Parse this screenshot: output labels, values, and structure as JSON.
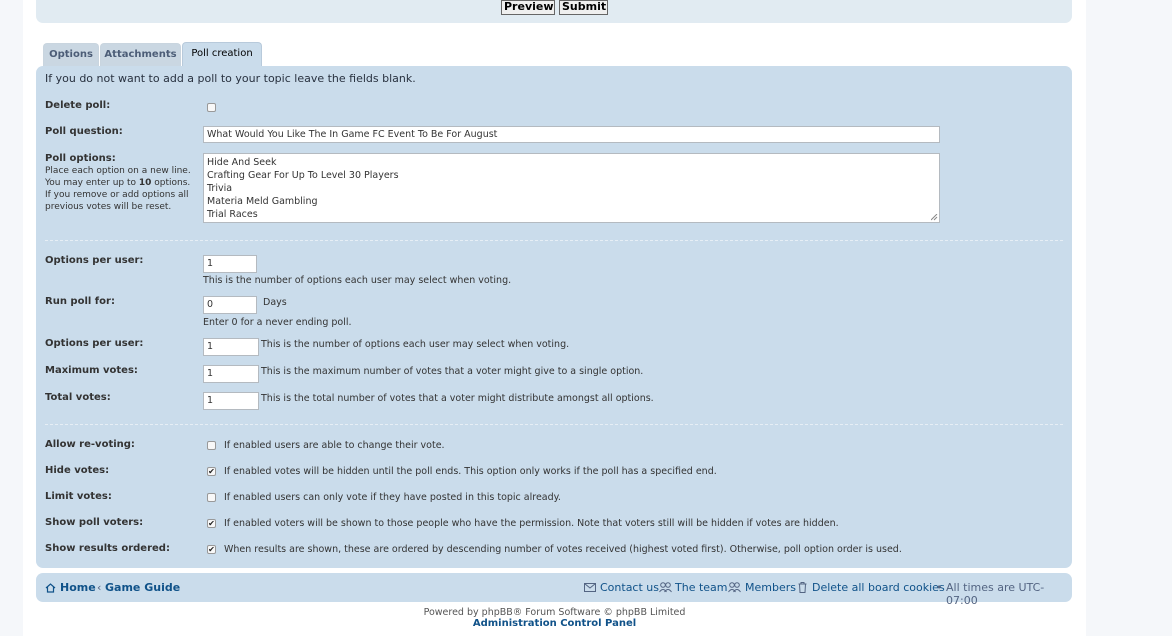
{
  "buttons": {
    "preview": "Preview",
    "submit": "Submit"
  },
  "tabs": [
    {
      "label": "Options"
    },
    {
      "label": "Attachments"
    },
    {
      "label": "Poll creation"
    }
  ],
  "poll": {
    "intro": "If you do not want to add a poll to your topic leave the fields blank.",
    "delete_label": "Delete poll:",
    "question_label": "Poll question:",
    "question_value": "What Would You Like The In Game FC Event To Be For August",
    "options_label": "Poll options:",
    "options_desc_1": "Place each option on a new line. You may enter up to ",
    "options_desc_bold": "10",
    "options_desc_2": " options. If you remove or add options all previous votes will be reset.",
    "options": [
      "Hide And Seek",
      "Crafting Gear For Up To Level 30 Players",
      "Trivia",
      "Materia Meld Gambling",
      "Trial Races"
    ],
    "opts_per_user_label": "Options per user:",
    "opts_per_user_value": "1",
    "opts_per_user_help": "This is the number of options each user may select when voting.",
    "run_label": "Run poll for:",
    "run_value": "0",
    "run_unit": "Days",
    "run_help": "Enter 0 for a never ending poll.",
    "opts_per_user2_label": "Options per user:",
    "opts_per_user2_value": "1",
    "opts_per_user2_help": "This is the number of options each user may select when voting.",
    "max_votes_label": "Maximum votes:",
    "max_votes_value": "1",
    "max_votes_help": "This is the maximum number of votes that a voter might give to a single option.",
    "total_votes_label": "Total votes:",
    "total_votes_value": "1",
    "total_votes_help": "This is the total number of votes that a voter might distribute amongst all options.",
    "revote_label": "Allow re-voting:",
    "revote_help": "If enabled users are able to change their vote.",
    "revote_checked": false,
    "hide_label": "Hide votes:",
    "hide_help": "If enabled votes will be hidden until the poll ends. This option only works if the poll has a specified end.",
    "hide_checked": true,
    "limit_label": "Limit votes:",
    "limit_help": "If enabled users can only vote if they have posted in this topic already.",
    "limit_checked": false,
    "voters_label": "Show poll voters:",
    "voters_help": "If enabled voters will be shown to those people who have the permission. Note that voters still will be hidden if votes are hidden.",
    "voters_checked": true,
    "ordered_label": "Show results ordered:",
    "ordered_help": "When results are shown, these are ordered by descending number of votes received (highest voted first). Otherwise, poll option order is used.",
    "ordered_checked": true
  },
  "footer": {
    "home": "Home",
    "separator": "‹",
    "forum": "Game Guide",
    "contact": "Contact us",
    "team": "The team",
    "members": "Members",
    "delete_cookies": "Delete all board cookies",
    "bullet": "•",
    "timezone": "All times are UTC-07:00",
    "powered": "Powered by phpBB® Forum Software © phpBB Limited",
    "acp": "Administration Control Panel"
  },
  "icons": {
    "home": "home-icon",
    "contact": "envelope-icon",
    "team": "team-icon",
    "members": "members-icon",
    "trash": "trash-icon"
  }
}
